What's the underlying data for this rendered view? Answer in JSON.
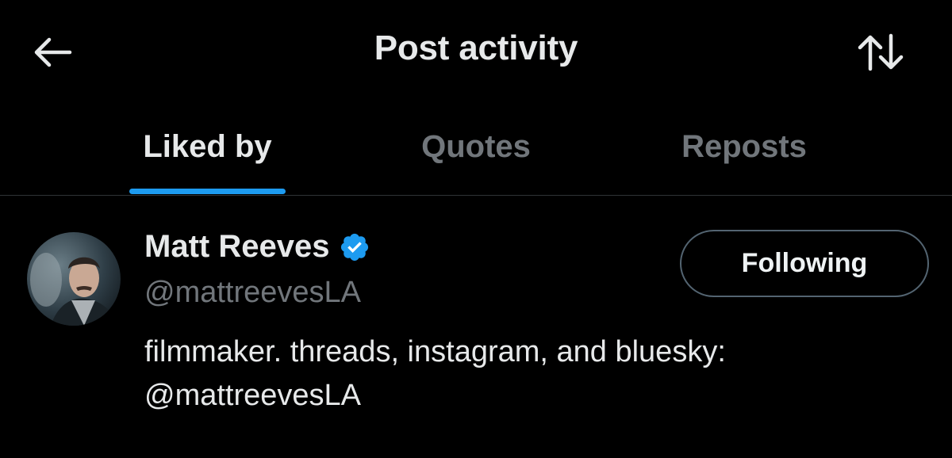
{
  "header": {
    "title": "Post activity",
    "back_icon": "arrow-left-icon",
    "sort_icon": "sort-arrows-icon"
  },
  "tabs": [
    {
      "label": "Liked by",
      "active": true
    },
    {
      "label": "Quotes",
      "active": false
    },
    {
      "label": "Reposts",
      "active": false
    }
  ],
  "user": {
    "display_name": "Matt Reeves",
    "verified": true,
    "handle": "@mattreevesLA",
    "bio_line1": "filmmaker. threads, instagram, and bluesky:",
    "bio_line2": "@mattreevesLA",
    "follow_label": "Following"
  },
  "colors": {
    "background": "#000000",
    "text_primary": "#e7e9ea",
    "text_secondary": "#71767b",
    "accent": "#1d9bf0",
    "border": "#2f3336"
  }
}
